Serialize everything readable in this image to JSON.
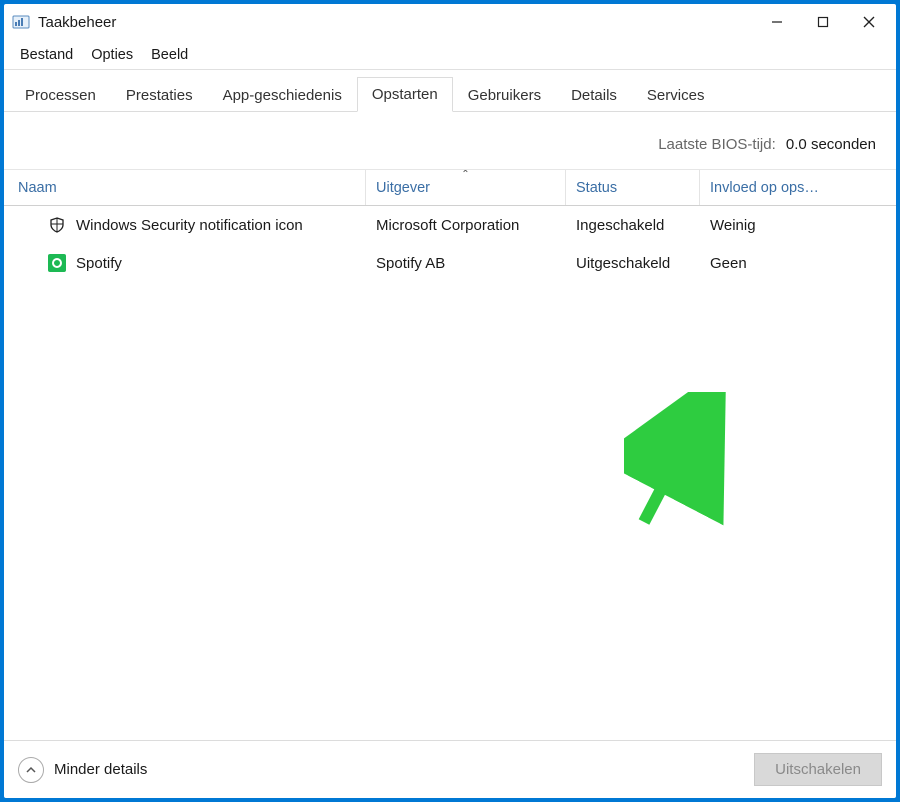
{
  "window": {
    "title": "Taakbeheer"
  },
  "menubar": {
    "items": [
      "Bestand",
      "Opties",
      "Beeld"
    ]
  },
  "tabs": {
    "items": [
      "Processen",
      "Prestaties",
      "App-geschiedenis",
      "Opstarten",
      "Gebruikers",
      "Details",
      "Services"
    ],
    "active_index": 3
  },
  "bios": {
    "label": "Laatste BIOS-tijd:",
    "value": "0.0 seconden"
  },
  "columns": {
    "name": "Naam",
    "publisher": "Uitgever",
    "status": "Status",
    "impact": "Invloed op ops…",
    "sortIndicator": "⌃"
  },
  "rows": [
    {
      "icon": "shield-icon",
      "name": "Windows Security notification icon",
      "publisher": "Microsoft Corporation",
      "status": "Ingeschakeld",
      "impact": "Weinig"
    },
    {
      "icon": "spotify-icon",
      "name": "Spotify",
      "publisher": "Spotify AB",
      "status": "Uitgeschakeld",
      "impact": "Geen"
    }
  ],
  "footer": {
    "fewer_details": "Minder details",
    "disable_button": "Uitschakelen"
  }
}
